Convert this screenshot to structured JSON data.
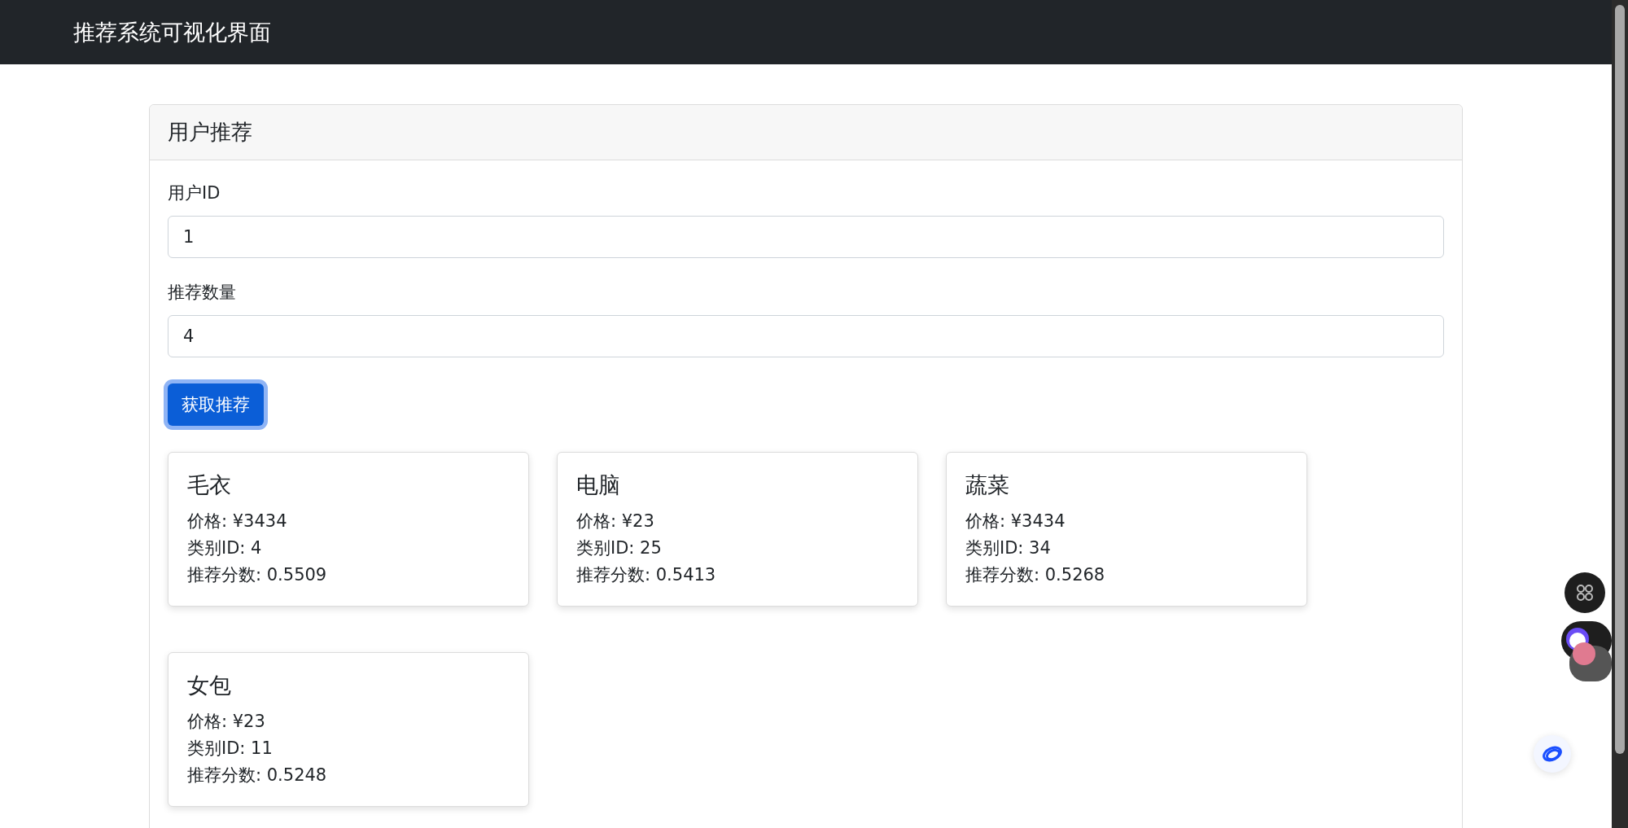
{
  "navbar": {
    "title": "推荐系统可视化界面"
  },
  "panel": {
    "title": "用户推荐",
    "fields": [
      {
        "label": "用户ID",
        "value": "1"
      },
      {
        "label": "推荐数量",
        "value": "4"
      }
    ],
    "button": {
      "label": "获取推荐",
      "focused": true
    },
    "results": [
      {
        "name": "毛衣",
        "lines": [
          "价格: ¥3434",
          "类别ID: 4",
          "推荐分数: 0.5509"
        ]
      },
      {
        "name": "电脑",
        "lines": [
          "价格: ¥23",
          "类别ID: 25",
          "推荐分数: 0.5413"
        ]
      },
      {
        "name": "蔬菜",
        "lines": [
          "价格: ¥3434",
          "类别ID: 34",
          "推荐分数: 0.5268"
        ]
      },
      {
        "name": "女包",
        "lines": [
          "价格: ¥23",
          "类别ID: 11",
          "推荐分数: 0.5248"
        ]
      }
    ]
  }
}
